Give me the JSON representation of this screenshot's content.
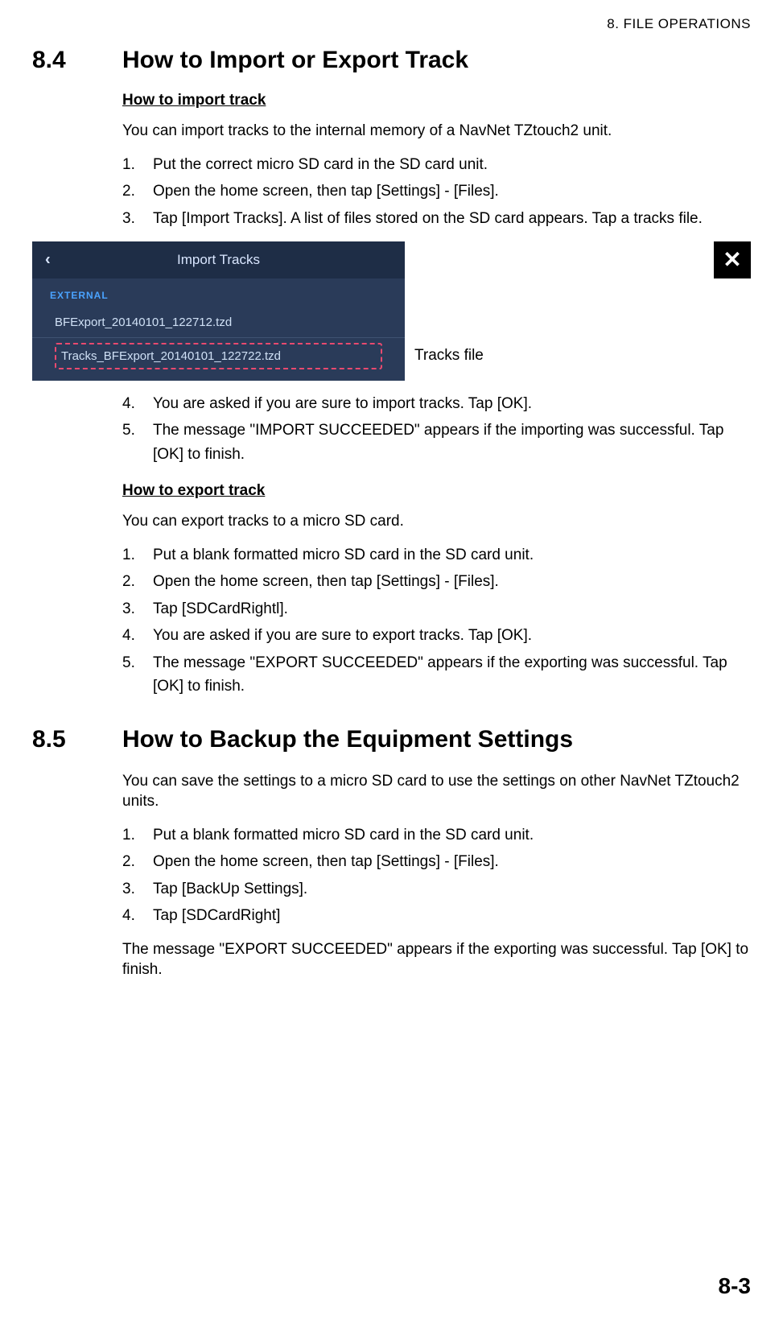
{
  "header": {
    "chapter": "8.  FILE OPERATIONS"
  },
  "section84": {
    "num": "8.4",
    "title": "How to Import or Export Track",
    "import": {
      "head": "How to import track",
      "intro": "You can import tracks to the internal memory of a NavNet TZtouch2 unit.",
      "steps_a": [
        "Put the correct micro SD card in the SD card unit.",
        "Open the home screen, then tap [Settings] - [Files].",
        "Tap [Import Tracks]. A list of files stored on the SD card appears. Tap a tracks file."
      ],
      "steps_b_start": 4,
      "steps_b": [
        "You are asked if you are sure to import tracks. Tap [OK].",
        "The message \"IMPORT SUCCEEDED\" appears if the importing was successful. Tap [OK] to finish."
      ]
    },
    "ui": {
      "title": "Import Tracks",
      "back": "‹",
      "close": "✕",
      "section_label": "EXTERNAL",
      "file1": "BFExport_20140101_122712.tzd",
      "file2": "Tracks_BFExport_20140101_122722.tzd",
      "callout": "Tracks file"
    },
    "export": {
      "head": "How to export track",
      "intro": "You can export tracks to a micro SD card.",
      "steps": [
        "Put a blank formatted micro SD card in the SD card unit.",
        "Open the home screen, then tap [Settings] - [Files].",
        "Tap [SDCardRightl].",
        "You are asked if you are sure to export tracks. Tap [OK].",
        "The message \"EXPORT SUCCEEDED\" appears if the exporting was successful. Tap [OK] to finish."
      ]
    }
  },
  "section85": {
    "num": "8.5",
    "title": "How to Backup the Equipment Settings",
    "intro": "You can save the settings to a micro SD card to use the settings on other NavNet TZtouch2 units.",
    "steps": [
      "Put a blank formatted micro SD card in the SD card unit.",
      "Open the home screen, then tap [Settings] - [Files].",
      "Tap [BackUp Settings].",
      "Tap [SDCardRight]"
    ],
    "outro": "The message \"EXPORT SUCCEEDED\" appears if the exporting was successful. Tap [OK] to finish."
  },
  "page": "8-3"
}
